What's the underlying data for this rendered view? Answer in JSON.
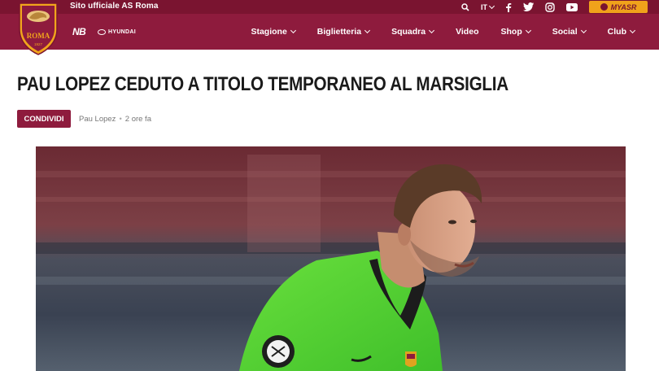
{
  "topbar": {
    "site_label": "Sito ufficiale AS Roma",
    "language": "IT",
    "myasr_label": "MYASR",
    "icons": [
      "search-icon",
      "facebook-icon",
      "twitter-icon",
      "instagram-icon",
      "youtube-icon"
    ]
  },
  "logo": {
    "text": "ROMA",
    "year": "1927"
  },
  "sponsors": {
    "kit": "NB",
    "main": "HYUNDAI"
  },
  "nav": {
    "items": [
      {
        "label": "Stagione",
        "dropdown": true
      },
      {
        "label": "Biglietteria",
        "dropdown": true
      },
      {
        "label": "Squadra",
        "dropdown": true
      },
      {
        "label": "Video",
        "dropdown": false
      },
      {
        "label": "Shop",
        "dropdown": true
      },
      {
        "label": "Social",
        "dropdown": true
      },
      {
        "label": "Club",
        "dropdown": true
      }
    ]
  },
  "article": {
    "title": "PAU LOPEZ CEDUTO A TITOLO TEMPORANEO AL MARSIGLIA",
    "share_label": "CONDIVIDI",
    "author": "Pau Lopez",
    "separator": "•",
    "time": "2 ore fa"
  },
  "colors": {
    "topbar": "#7a1430",
    "navbar": "#8e1b3d",
    "accent": "#f0a21b",
    "jersey": "#5fd63b"
  }
}
